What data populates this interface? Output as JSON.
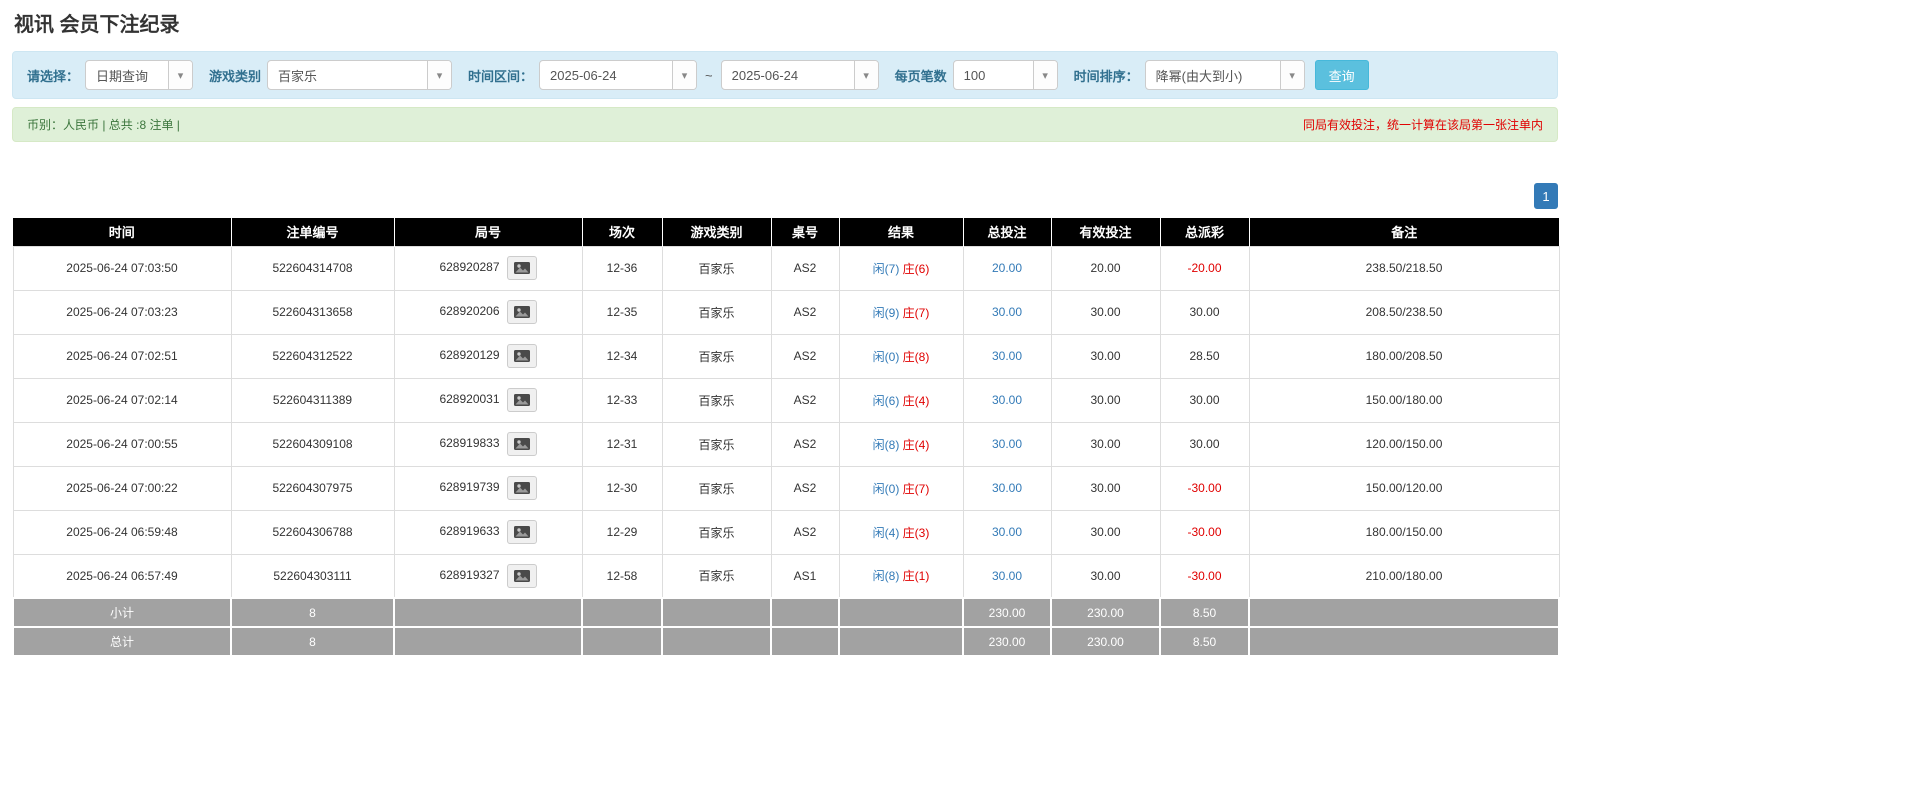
{
  "page": {
    "title": "视讯 会员下注纪录"
  },
  "icons": {
    "chevron_down": "▾"
  },
  "colors": {
    "accent_blue": "#337ab7",
    "info_bar_bg": "#d9edf7",
    "success_bar_bg": "#dff0d8",
    "warning_red": "#e00000",
    "table_header_bg": "#000000",
    "table_footer_bg": "#a2a2a2",
    "search_button_bg": "#5bc0de"
  },
  "filters": {
    "select_label": "请选择：",
    "select_value": "日期查询",
    "game_type_label": "游戏类别",
    "game_type_value": "百家乐",
    "time_range_label": "时间区间：",
    "date_from": "2025-06-24",
    "range_separator": "~",
    "date_to": "2025-06-24",
    "per_page_label": "每页笔数",
    "per_page_value": "100",
    "sort_label": "时间排序：",
    "sort_value": "降幂(由大到小)",
    "search_button": "查询"
  },
  "summary": {
    "left": "币别：人民币 | 总共 :8 注单 |",
    "warning": "同局有效投注，统一计算在该局第一张注单内"
  },
  "pagination": {
    "current_page": "1"
  },
  "table": {
    "headers": [
      "时间",
      "注单编号",
      "局号",
      "场次",
      "游戏类别",
      "桌号",
      "结果",
      "总投注",
      "有效投注",
      "总派彩",
      "备注"
    ],
    "rows": [
      {
        "time": "2025-06-24 07:03:50",
        "bet_id": "522604314708",
        "round_id": "628920287",
        "session": "12-36",
        "game": "百家乐",
        "table_no": "AS2",
        "result_player": "闲(7)",
        "result_banker": "庄(6)",
        "total_bet": "20.00",
        "valid_bet": "20.00",
        "payout": "-20.00",
        "note": "238.50/218.50"
      },
      {
        "time": "2025-06-24 07:03:23",
        "bet_id": "522604313658",
        "round_id": "628920206",
        "session": "12-35",
        "game": "百家乐",
        "table_no": "AS2",
        "result_player": "闲(9)",
        "result_banker": "庄(7)",
        "total_bet": "30.00",
        "valid_bet": "30.00",
        "payout": "30.00",
        "note": "208.50/238.50"
      },
      {
        "time": "2025-06-24 07:02:51",
        "bet_id": "522604312522",
        "round_id": "628920129",
        "session": "12-34",
        "game": "百家乐",
        "table_no": "AS2",
        "result_player": "闲(0)",
        "result_banker": "庄(8)",
        "total_bet": "30.00",
        "valid_bet": "30.00",
        "payout": "28.50",
        "note": "180.00/208.50"
      },
      {
        "time": "2025-06-24 07:02:14",
        "bet_id": "522604311389",
        "round_id": "628920031",
        "session": "12-33",
        "game": "百家乐",
        "table_no": "AS2",
        "result_player": "闲(6)",
        "result_banker": "庄(4)",
        "total_bet": "30.00",
        "valid_bet": "30.00",
        "payout": "30.00",
        "note": "150.00/180.00"
      },
      {
        "time": "2025-06-24 07:00:55",
        "bet_id": "522604309108",
        "round_id": "628919833",
        "session": "12-31",
        "game": "百家乐",
        "table_no": "AS2",
        "result_player": "闲(8)",
        "result_banker": "庄(4)",
        "total_bet": "30.00",
        "valid_bet": "30.00",
        "payout": "30.00",
        "note": "120.00/150.00"
      },
      {
        "time": "2025-06-24 07:00:22",
        "bet_id": "522604307975",
        "round_id": "628919739",
        "session": "12-30",
        "game": "百家乐",
        "table_no": "AS2",
        "result_player": "闲(0)",
        "result_banker": "庄(7)",
        "total_bet": "30.00",
        "valid_bet": "30.00",
        "payout": "-30.00",
        "note": "150.00/120.00"
      },
      {
        "time": "2025-06-24 06:59:48",
        "bet_id": "522604306788",
        "round_id": "628919633",
        "session": "12-29",
        "game": "百家乐",
        "table_no": "AS2",
        "result_player": "闲(4)",
        "result_banker": "庄(3)",
        "total_bet": "30.00",
        "valid_bet": "30.00",
        "payout": "-30.00",
        "note": "180.00/150.00"
      },
      {
        "time": "2025-06-24 06:57:49",
        "bet_id": "522604303111",
        "round_id": "628919327",
        "session": "12-58",
        "game": "百家乐",
        "table_no": "AS1",
        "result_player": "闲(8)",
        "result_banker": "庄(1)",
        "total_bet": "30.00",
        "valid_bet": "30.00",
        "payout": "-30.00",
        "note": "210.00/180.00"
      }
    ],
    "footer": [
      {
        "label": "小计",
        "count": "8",
        "total_bet": "230.00",
        "valid_bet": "230.00",
        "payout": "8.50"
      },
      {
        "label": "总计",
        "count": "8",
        "total_bet": "230.00",
        "valid_bet": "230.00",
        "payout": "8.50"
      }
    ]
  }
}
